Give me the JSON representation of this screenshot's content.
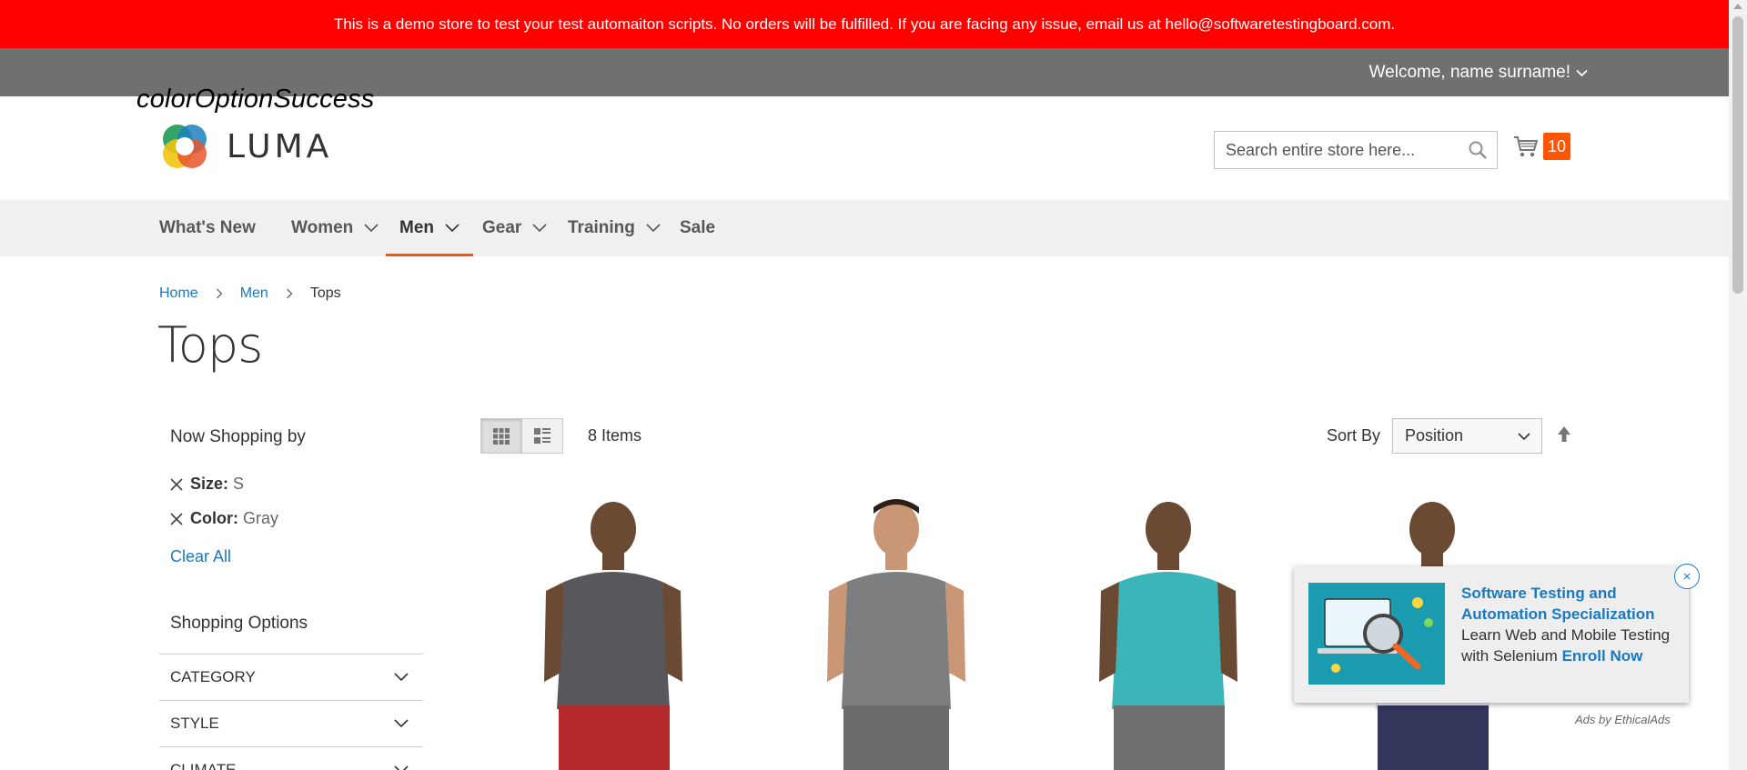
{
  "banner": {
    "text": "This is a demo store to test your test automaiton scripts. No orders will be fulfilled. If you are facing any issue, email us at hello@softwaretestingboard.com."
  },
  "header": {
    "welcome": "Welcome, name surname!",
    "overlay_label": "colorOptionSuccess",
    "logo_text": "LUMA",
    "search_placeholder": "Search entire store here...",
    "cart_count": "10"
  },
  "nav": {
    "items": [
      {
        "label": "What's New",
        "has_children": false
      },
      {
        "label": "Women",
        "has_children": true
      },
      {
        "label": "Men",
        "has_children": true,
        "active": true
      },
      {
        "label": "Gear",
        "has_children": true
      },
      {
        "label": "Training",
        "has_children": true
      },
      {
        "label": "Sale",
        "has_children": false
      }
    ]
  },
  "breadcrumb": {
    "items": [
      "Home",
      "Men"
    ],
    "current": "Tops"
  },
  "page_title": "Tops",
  "sidebar": {
    "now_shopping_title": "Now Shopping by",
    "filters": [
      {
        "label": "Size:",
        "value": "S"
      },
      {
        "label": "Color:",
        "value": "Gray"
      }
    ],
    "clear_all": "Clear All",
    "shopping_options_title": "Shopping Options",
    "options": [
      "CATEGORY",
      "STYLE",
      "CLIMATE"
    ]
  },
  "toolbar": {
    "items_count": "8 Items",
    "sort_label": "Sort By",
    "sort_value": "Position"
  },
  "products": [
    {
      "shirt_color": "#58575c",
      "shorts_color": "#b52a2a"
    },
    {
      "shirt_color": "#7d7e7f",
      "shorts_color": "#6b6b6b"
    },
    {
      "shirt_color": "#3cb5b8",
      "shorts_color": "#6f6f6f"
    },
    {
      "shirt_color": "#ededed",
      "shorts_color": "#33355a"
    }
  ],
  "ad": {
    "title": "Software Testing and Automation Specialization",
    "body": "Learn Web and Mobile Testing with Selenium",
    "cta": "Enroll Now",
    "close": "×",
    "ads_by": "Ads by EthicalAds"
  },
  "colors": {
    "banner_bg": "#ff0000",
    "panel_bg": "#6e716e",
    "accent": "#ff5501",
    "link": "#1979c3"
  }
}
